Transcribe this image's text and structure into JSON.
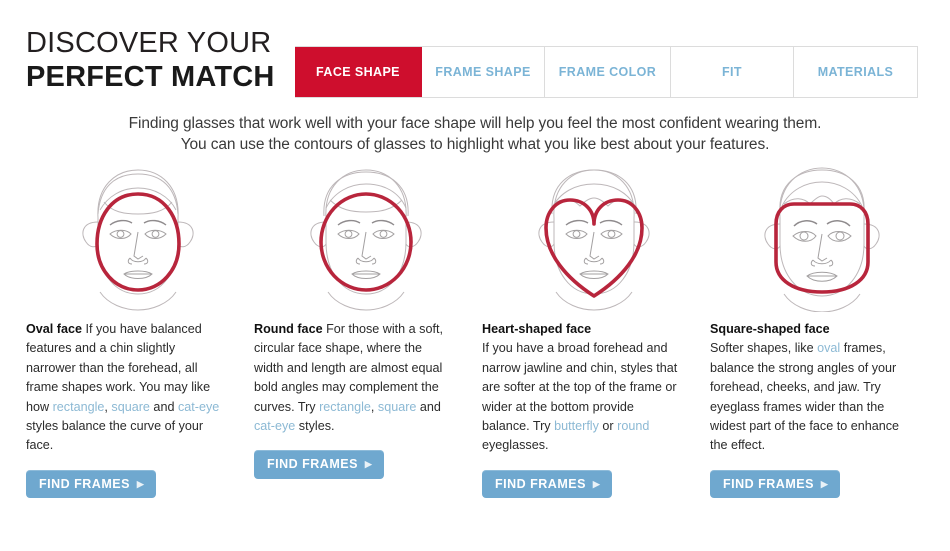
{
  "header": {
    "title_line1": "DISCOVER YOUR",
    "title_line2": "PERFECT MATCH"
  },
  "tabs": [
    {
      "label": "FACE SHAPE",
      "active": true
    },
    {
      "label": "FRAME SHAPE",
      "active": false
    },
    {
      "label": "FRAME COLOR",
      "active": false
    },
    {
      "label": "FIT",
      "active": false
    },
    {
      "label": "MATERIALS",
      "active": false
    }
  ],
  "subtitle": {
    "line1": "Finding glasses that work well with your face shape will help you feel the most confident wearing them.",
    "line2": "You can use the contours of glasses to highlight what you like best about your features."
  },
  "cards": [
    {
      "shape": "oval",
      "heading": "Oval face",
      "body_parts": [
        {
          "text": " If you have balanced features and a chin slightly narrower than the forehead, all frame shapes work. You may like how ",
          "link": false
        },
        {
          "text": "rectangle",
          "link": true
        },
        {
          "text": ", ",
          "link": false
        },
        {
          "text": "square",
          "link": true
        },
        {
          "text": " and ",
          "link": false
        },
        {
          "text": "cat-eye",
          "link": true
        },
        {
          "text": " styles balance the curve of your face.",
          "link": false
        }
      ],
      "button_label": "FIND FRAMES"
    },
    {
      "shape": "round",
      "heading": "Round face",
      "body_parts": [
        {
          "text": " For those with a soft, circular face shape, where the width and length are almost equal bold angles may complement the curves. Try ",
          "link": false
        },
        {
          "text": "rectangle",
          "link": true
        },
        {
          "text": ", ",
          "link": false
        },
        {
          "text": "square",
          "link": true
        },
        {
          "text": " and ",
          "link": false
        },
        {
          "text": "cat-eye",
          "link": true
        },
        {
          "text": " styles.",
          "link": false
        }
      ],
      "button_label": "FIND FRAMES"
    },
    {
      "shape": "heart",
      "heading": "Heart-shaped face",
      "body_parts": [
        {
          "text": "If you have a broad forehead and narrow jawline and chin, styles that are softer at the top of the frame or wider at the bottom provide balance. Try ",
          "link": false
        },
        {
          "text": "butterfly",
          "link": true
        },
        {
          "text": " or ",
          "link": false
        },
        {
          "text": "round",
          "link": true
        },
        {
          "text": " eyeglasses.",
          "link": false
        }
      ],
      "button_label": "FIND FRAMES"
    },
    {
      "shape": "square",
      "heading": "Square-shaped face",
      "body_parts": [
        {
          "text": "Softer shapes, like ",
          "link": false
        },
        {
          "text": "oval",
          "link": true
        },
        {
          "text": " frames, balance the strong angles of your forehead, cheeks, and jaw. Try eyeglass frames wider than the widest part of the face to enhance the effect.",
          "link": false
        }
      ],
      "button_label": "FIND FRAMES"
    }
  ],
  "colors": {
    "accent_red": "#ce0e2d",
    "accent_blue": "#6fa8cf",
    "tab_text_blue": "#7bb4d6",
    "link_blue": "#8cb9d4",
    "shape_outline_red": "#b8253c",
    "face_line": "#b9b4b6"
  },
  "icons": {
    "caret": "▶"
  }
}
